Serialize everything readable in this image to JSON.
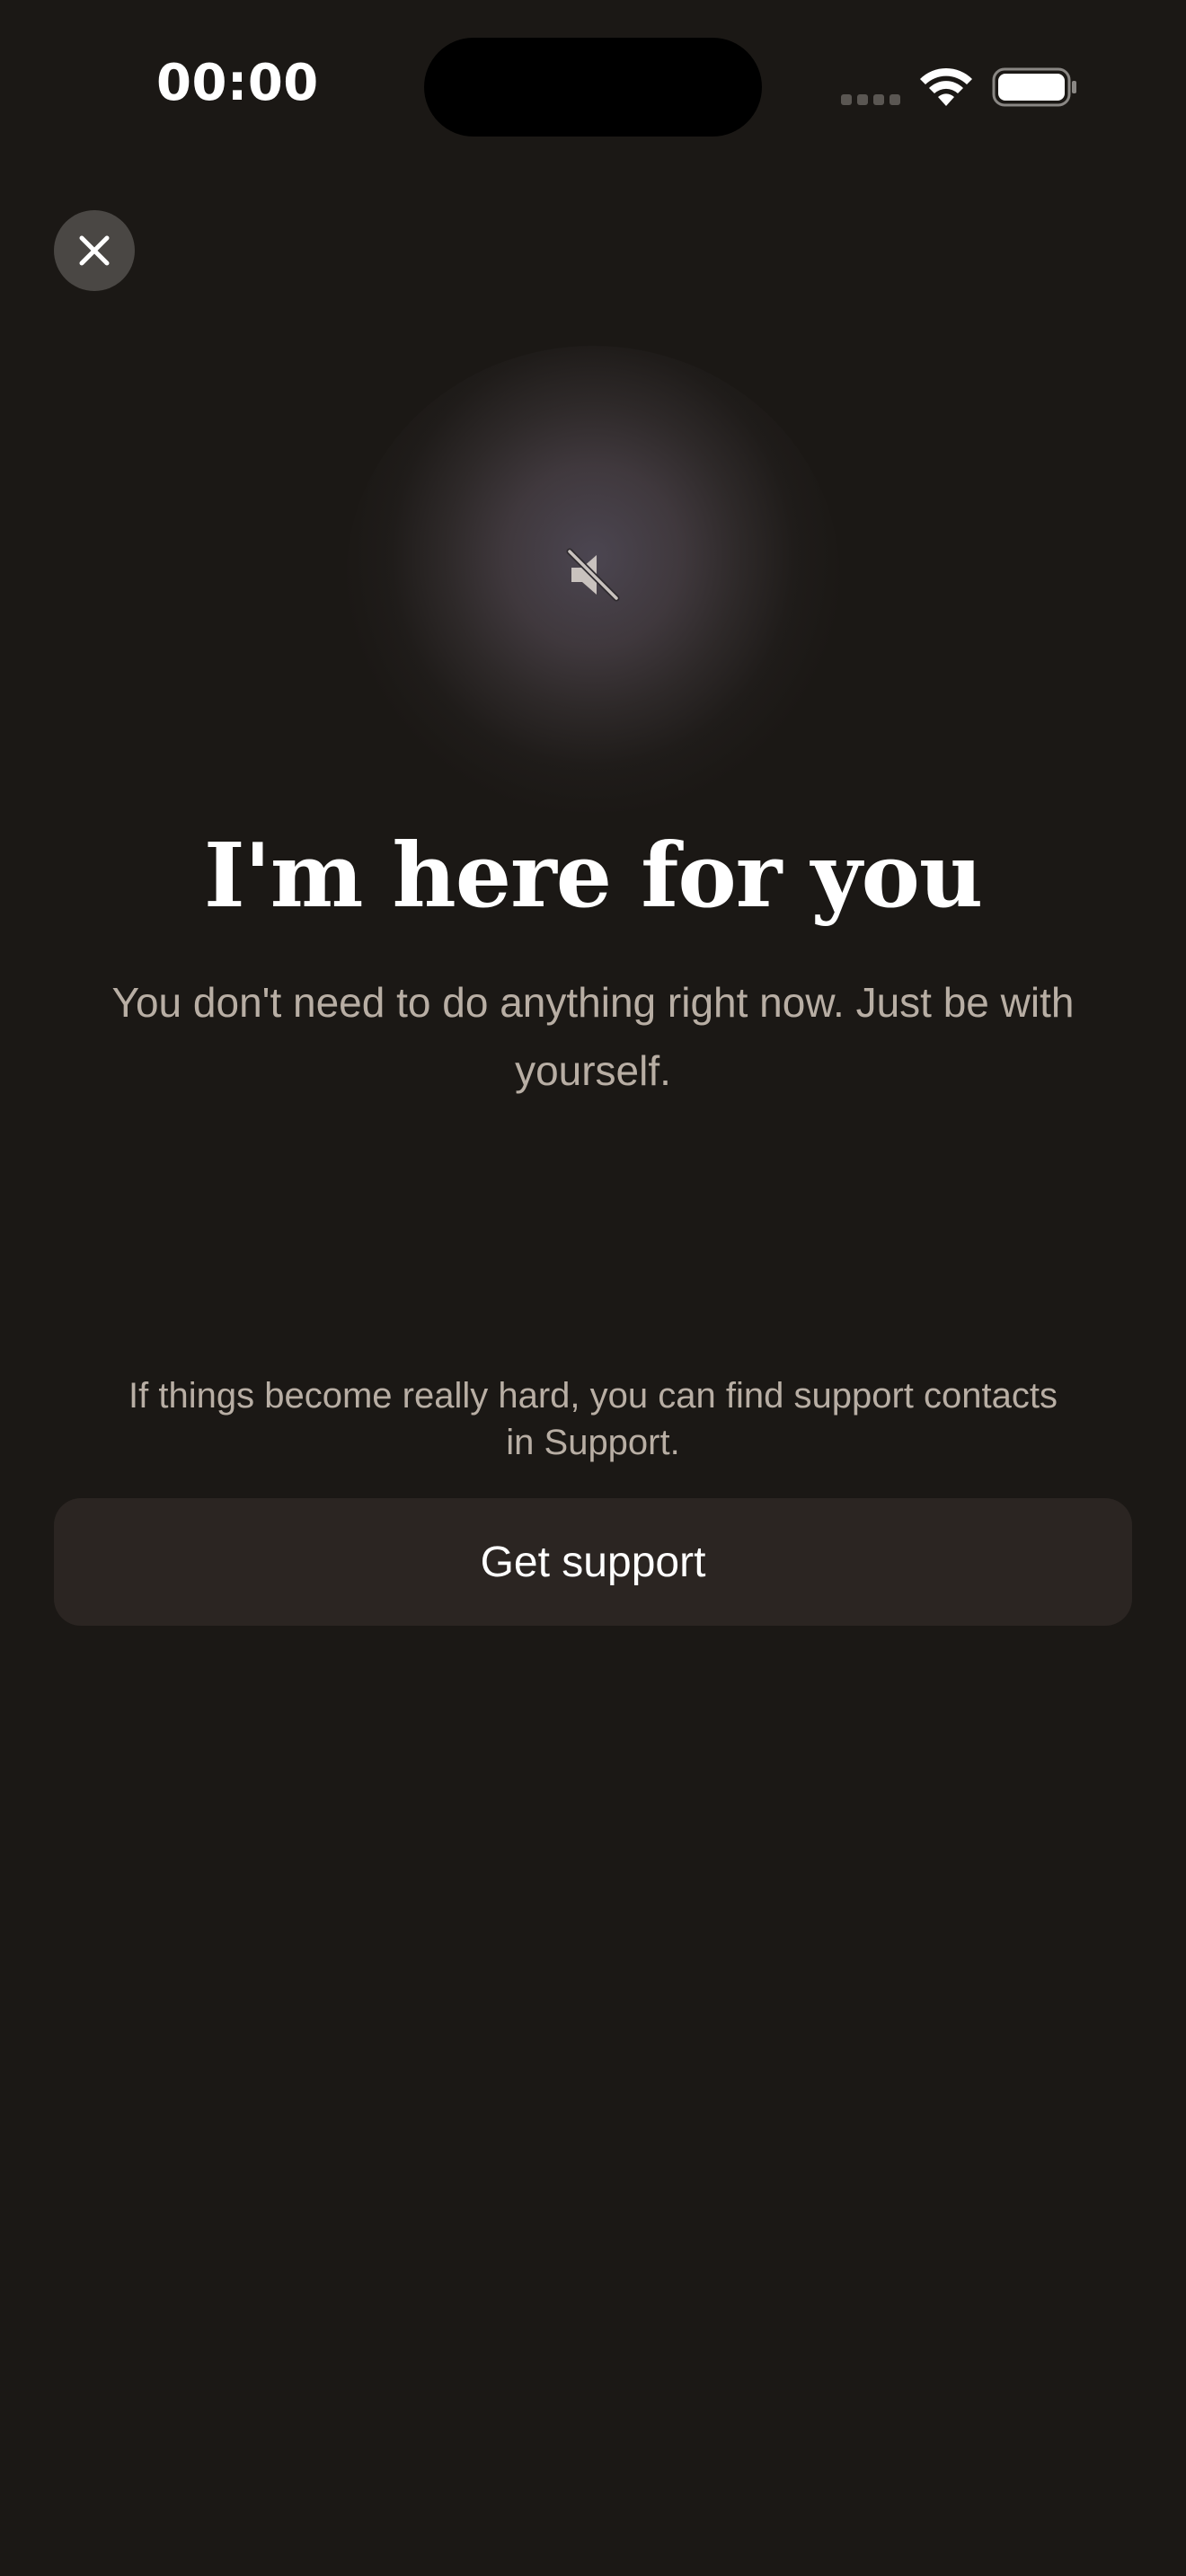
{
  "status_bar": {
    "time": "00:00",
    "signal_icon": "cellular-signal-icon",
    "wifi_icon": "wifi-icon",
    "battery_icon": "battery-icon"
  },
  "header": {
    "close_icon": "close-icon"
  },
  "orb": {
    "mute_icon": "speaker-muted-icon"
  },
  "main": {
    "headline": "I'm here for you",
    "subtext": "You don't need to do anything right now. Just be with yourself.",
    "support_note": "If things become really hard, you can find support contacts in Support.",
    "get_support_label": "Get support"
  },
  "colors": {
    "background": "#1b1815",
    "button_background": "#2b2522",
    "secondary_text": "#b8aea4",
    "close_button_background": "#4a4744"
  }
}
